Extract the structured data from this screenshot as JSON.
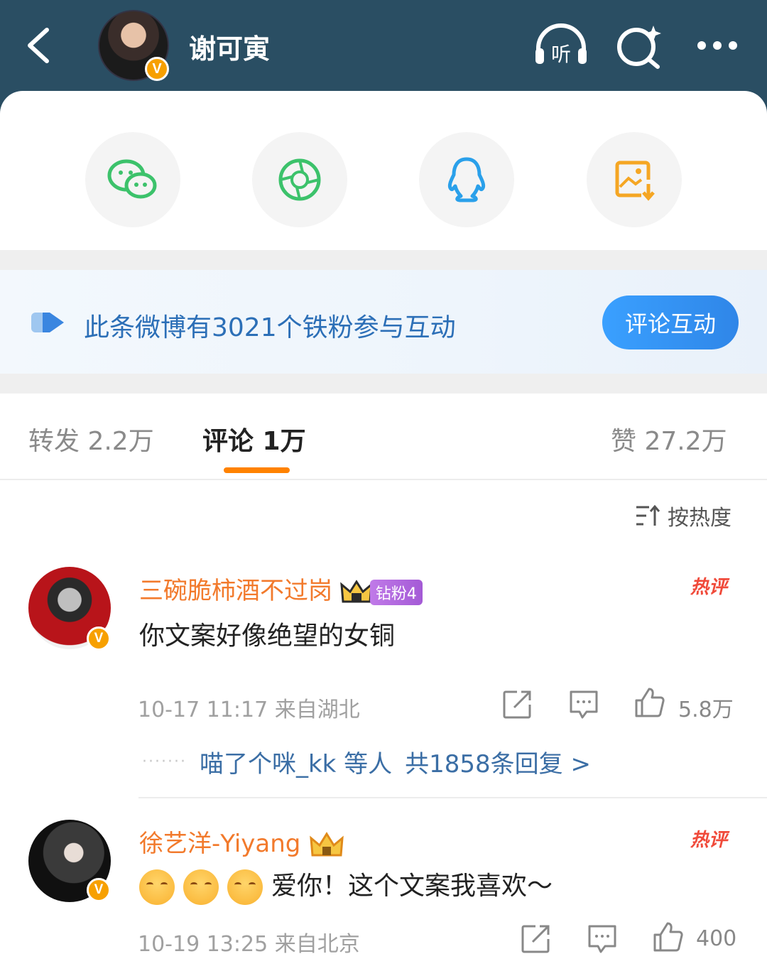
{
  "header": {
    "title": "谢可寅",
    "verified_badge": "V",
    "icons": [
      "back-icon",
      "listen-icon",
      "search-icon",
      "more-icon"
    ],
    "listen_label": "听"
  },
  "share": {
    "items": [
      "wechat-icon",
      "moments-icon",
      "qq-icon",
      "save-image-icon"
    ]
  },
  "fan_banner": {
    "text": "此条微博有3021个铁粉参与互动",
    "button": "评论互动"
  },
  "tabs": {
    "repost": "转发 2.2万",
    "comment": "评论 1万",
    "like": "赞 27.2万"
  },
  "sort": {
    "label": "按热度"
  },
  "comments": [
    {
      "name": "三碗脆柿酒不过岗",
      "fan_level": "钻粉4",
      "text": "你文案好像绝望的女铜",
      "hot": "热评",
      "time": "10-17 11:17",
      "location": "来自湖北",
      "likes": "5.8万",
      "replies_prefix": "喵了个咪_kk 等人",
      "replies_count": "共1858条回复 >"
    },
    {
      "name": "徐艺洋-Yiyang",
      "text": "爱你！这个文案我喜欢～",
      "hot": "热评",
      "time": "10-19 13:25",
      "location": "来自北京",
      "likes": "400"
    }
  ],
  "colors": {
    "header_bg": "#2a4e63",
    "accent": "#ff8200",
    "name": "#f27a2c",
    "link": "#3b6ea5"
  }
}
